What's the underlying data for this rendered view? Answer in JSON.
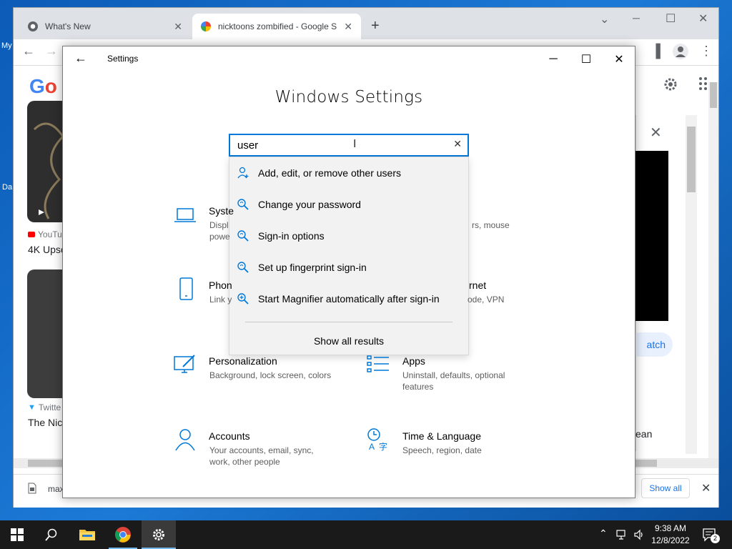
{
  "desktop": {
    "left_label_1": "My",
    "left_label_2": "Da"
  },
  "chrome": {
    "tabs": [
      {
        "title": "What's New",
        "close": "✕"
      },
      {
        "title": "nicktoons zombified - Google Se",
        "close": "✕"
      }
    ],
    "new_tab": "+",
    "window_controls": {
      "minimize": "─",
      "maximize": "☐",
      "close": "✕",
      "tabsearch": "⌄"
    },
    "nav": {
      "back": "←",
      "forward": "→"
    },
    "toolbar_right": {
      "sidepanel": "▐",
      "menu": "⋮"
    }
  },
  "page": {
    "logo_partial": "Go",
    "card1": {
      "source": "YouTu",
      "title": "4K Upsc"
    },
    "card2": {
      "source": "Twitte",
      "title": "The Nic"
    },
    "panel_close": "✕",
    "watch_btn": "atch",
    "side_text": "ean",
    "download_file": "max",
    "show_all": "Show all",
    "download_close": "✕"
  },
  "settings": {
    "back": "←",
    "title": "Settings",
    "controls": {
      "minimize": "─",
      "maximize": "☐",
      "close": "✕"
    },
    "heading": "Windows Settings",
    "search": {
      "value": "user",
      "clear": "✕"
    },
    "suggestions": [
      {
        "label": "Add, edit, or remove other users",
        "icon": "user-add-icon"
      },
      {
        "label": "Change your password",
        "icon": "key-search-icon"
      },
      {
        "label": "Sign-in options",
        "icon": "key-search-icon"
      },
      {
        "label": "Set up fingerprint sign-in",
        "icon": "key-search-icon"
      },
      {
        "label": "Start Magnifier automatically after sign-in",
        "icon": "magnifier-icon"
      }
    ],
    "show_all": "Show all results",
    "categories": {
      "system": {
        "title": "Syste",
        "desc1": "Displ",
        "desc2": "powe"
      },
      "devices_partial": {
        "desc": "rs, mouse"
      },
      "phone": {
        "title": "Phon",
        "desc": "Link y"
      },
      "network_partial": {
        "title": "rnet",
        "desc": "ode, VPN"
      },
      "personalization": {
        "title": "Personalization",
        "desc": "Background, lock screen, colors"
      },
      "apps": {
        "title": "Apps",
        "desc1": "Uninstall, defaults, optional",
        "desc2": "features"
      },
      "accounts": {
        "title": "Accounts",
        "desc1": "Your accounts, email, sync,",
        "desc2": "work, other people"
      },
      "time": {
        "title": "Time & Language",
        "desc": "Speech, region, date"
      }
    },
    "accent": "#0078d7"
  },
  "taskbar": {
    "time": "9:38 AM",
    "date": "12/8/2022",
    "notifications": "2"
  }
}
